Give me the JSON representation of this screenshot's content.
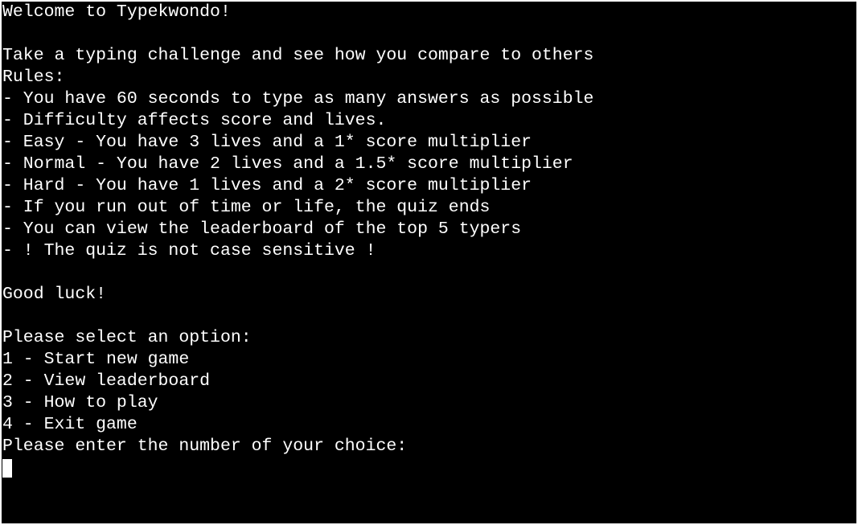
{
  "terminal": {
    "lines": [
      "Welcome to Typekwondo!",
      "",
      "Take a typing challenge and see how you compare to others",
      "Rules:",
      "- You have 60 seconds to type as many answers as possible",
      "- Difficulty affects score and lives.",
      "- Easy - You have 3 lives and a 1* score multiplier",
      "- Normal - You have 2 lives and a 1.5* score multiplier",
      "- Hard - You have 1 lives and a 2* score multiplier",
      "- If you run out of time or life, the quiz ends",
      "- You can view the leaderboard of the top 5 typers",
      "- ! The quiz is not case sensitive !",
      "",
      "Good luck!",
      "",
      "Please select an option:",
      "1 - Start new game",
      "2 - View leaderboard",
      "3 - How to play",
      "4 - Exit game",
      "Please enter the number of your choice:"
    ],
    "input_value": ""
  },
  "colors": {
    "background": "#000000",
    "foreground": "#ffffff",
    "frame": "#ffffff"
  }
}
